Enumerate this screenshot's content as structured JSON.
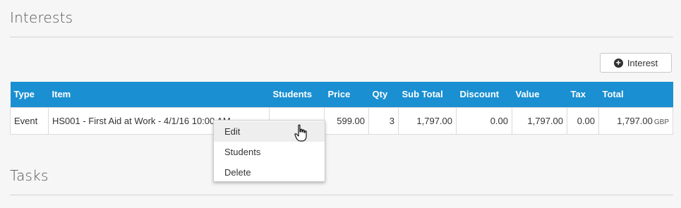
{
  "interests": {
    "title": "Interests",
    "add_button_label": "Interest",
    "columns": [
      "Type",
      "Item",
      "Students",
      "Price",
      "Qty",
      "Sub Total",
      "Discount",
      "Value",
      "Tax",
      "Total"
    ],
    "rows": [
      {
        "type": "Event",
        "item": "HS001 - First Aid at Work - 4/1/16 10:00 AM",
        "students": "",
        "price": "599.00",
        "qty": "3",
        "subtotal": "1,797.00",
        "discount": "0.00",
        "value": "1,797.00",
        "tax": "0.00",
        "total": "1,797.00",
        "currency": "GBP"
      }
    ]
  },
  "context_menu": {
    "items": [
      "Edit",
      "Students",
      "Delete"
    ],
    "hovered": "Edit"
  },
  "tasks": {
    "title": "Tasks"
  },
  "icons": {
    "add": "plus-circle-icon",
    "cursor": "hand-pointer-icon"
  },
  "colors": {
    "header_bg": "#1a8fd1"
  }
}
